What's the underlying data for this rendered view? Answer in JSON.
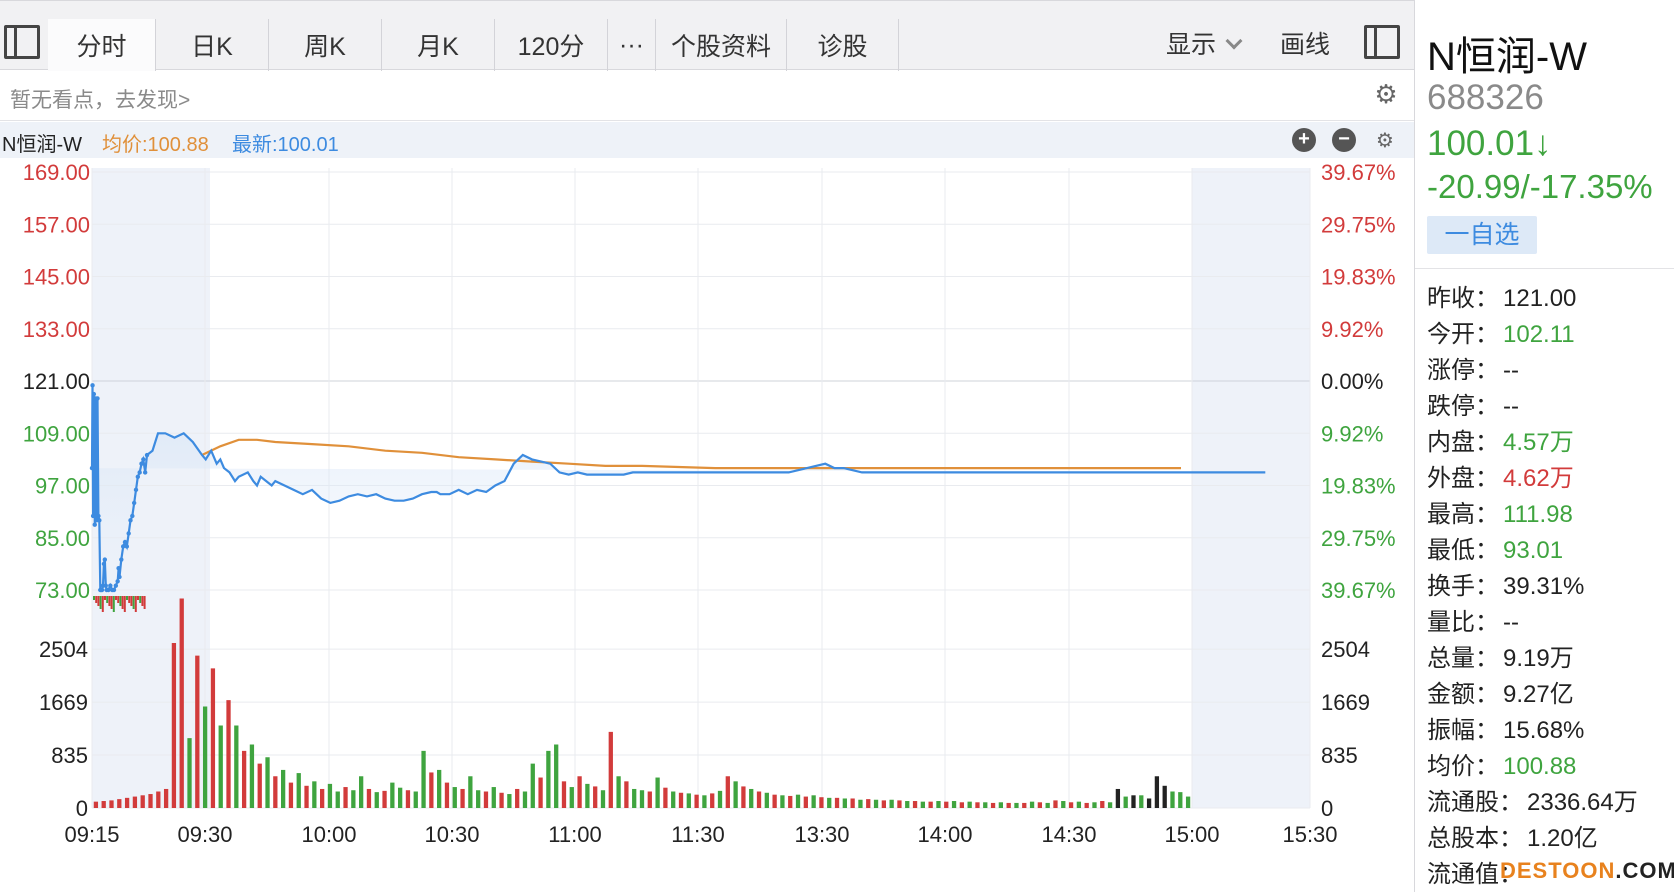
{
  "tabs": [
    {
      "label": "分时",
      "active": true
    },
    {
      "label": "日K",
      "active": false
    },
    {
      "label": "周K",
      "active": false
    },
    {
      "label": "月K",
      "active": false
    },
    {
      "label": "120分",
      "active": false
    },
    {
      "label": "···",
      "active": false
    },
    {
      "label": "个股资料",
      "active": false
    },
    {
      "label": "诊股",
      "active": false
    }
  ],
  "toolbar": {
    "display_label": "显示",
    "draw_label": "画线"
  },
  "hint_text": "暂无看点，去发现>",
  "legend": {
    "name": "N恒润-W",
    "avg": "均价:100.88",
    "latest": "最新:100.01"
  },
  "stock": {
    "name": "N恒润-W",
    "code": "688326",
    "price": "100.01↓",
    "change": "-20.99/-17.35%",
    "watch_label": "一自选"
  },
  "stats": [
    {
      "label": "昨收：",
      "value": "121.00",
      "color": "dark"
    },
    {
      "label": "今开：",
      "value": "102.11",
      "color": "green"
    },
    {
      "label": "涨停：",
      "value": "--",
      "color": "dark"
    },
    {
      "label": "跌停：",
      "value": "--",
      "color": "dark"
    },
    {
      "label": "内盘：",
      "value": "4.57万",
      "color": "green"
    },
    {
      "label": "外盘：",
      "value": "4.62万",
      "color": "red"
    },
    {
      "label": "最高：",
      "value": "111.98",
      "color": "green"
    },
    {
      "label": "最低：",
      "value": "93.01",
      "color": "green"
    },
    {
      "label": "换手：",
      "value": "39.31%",
      "color": "dark"
    },
    {
      "label": "量比：",
      "value": "--",
      "color": "dark"
    },
    {
      "label": "总量：",
      "value": "9.19万",
      "color": "dark"
    },
    {
      "label": "金额：",
      "value": "9.27亿",
      "color": "dark"
    },
    {
      "label": "振幅：",
      "value": "15.68%",
      "color": "dark"
    },
    {
      "label": "均价：",
      "value": "100.88",
      "color": "green"
    },
    {
      "label": "流通股：",
      "value": "2336.64万",
      "color": "dark"
    },
    {
      "label": "总股本：",
      "value": "1.20亿",
      "color": "dark"
    },
    {
      "label": "流通值：",
      "value": "",
      "color": "dark"
    }
  ],
  "watermark": {
    "brand": "DESTOON",
    "tail": ".COM"
  },
  "colors": {
    "up": "#d23b3b",
    "down": "#3fa43f",
    "price_line": "#3d8be0",
    "avg_line": "#e0903a"
  },
  "chart_data": {
    "type": "line",
    "price_axis": {
      "ticks": [
        169.0,
        157.0,
        145.0,
        133.0,
        121.0,
        109.0,
        97.0,
        85.0,
        73.0
      ],
      "labels": [
        "169.00",
        "157.00",
        "145.00",
        "133.00",
        "121.00",
        "109.00",
        "97.00",
        "85.00",
        "73.00"
      ],
      "pct_labels": [
        "39.67%",
        "29.75%",
        "19.83%",
        "9.92%",
        "0.00%",
        "9.92%",
        "19.83%",
        "29.75%",
        "39.67%"
      ],
      "prev_close": 121.0
    },
    "time_labels": [
      "09:15",
      "09:30",
      "10:00",
      "10:30",
      "11:00",
      "11:30",
      "13:30",
      "14:00",
      "14:30",
      "15:00",
      "15:30"
    ],
    "volume_axis": {
      "ticks": [
        2504,
        1669,
        835,
        0
      ],
      "labels": [
        "2504",
        "1669",
        "835",
        "0"
      ],
      "ylim": [
        0,
        3340
      ]
    },
    "series": [
      {
        "name": "最新",
        "t": [
          0,
          0.3,
          0.6,
          1,
          1.5,
          2,
          2.5,
          3,
          3.5,
          4,
          4.5,
          5,
          5.5,
          6,
          6.5,
          7,
          7.5,
          8,
          9,
          10,
          11,
          12,
          13,
          14,
          14.5,
          15,
          16,
          17,
          18,
          19,
          20,
          21,
          22,
          23,
          24,
          25,
          26,
          27,
          28,
          29,
          30,
          33,
          36,
          40,
          45,
          50,
          55,
          60,
          62,
          65,
          68,
          70,
          72,
          75,
          78,
          80,
          85,
          88,
          90,
          92,
          95,
          98,
          100,
          105,
          110,
          115,
          120,
          125,
          130,
          135,
          140,
          145,
          150,
          155,
          160,
          165,
          170,
          175,
          180,
          185,
          188,
          190,
          195,
          200,
          205,
          210,
          215,
          220,
          225,
          230,
          235,
          240,
          245,
          250,
          255,
          260,
          265,
          270,
          275,
          280,
          285,
          290,
          295,
          300,
          310,
          320,
          330,
          340,
          350,
          360,
          370,
          380,
          390,
          400,
          405,
          410,
          420,
          430,
          440,
          450,
          460,
          465,
          470,
          480,
          490,
          500,
          510,
          520,
          530,
          540,
          550,
          560,
          570,
          580,
          590,
          600,
          610,
          620,
          630,
          640,
          650,
          660
        ],
        "values": [
          101,
          120,
          90,
          118,
          88,
          117,
          89,
          117,
          90,
          89,
          73,
          73,
          73,
          74,
          79,
          80,
          74,
          73,
          73,
          74,
          73,
          73,
          74,
          75,
          78,
          76,
          80,
          83,
          84,
          83,
          86,
          89,
          90,
          93,
          96,
          99,
          100,
          102,
          103,
          100,
          104,
          105,
          109,
          109,
          108,
          109,
          107,
          104,
          103,
          105,
          102,
          103,
          101,
          100,
          98,
          99,
          100,
          98,
          97,
          99,
          98,
          97,
          98,
          97,
          96,
          95,
          96,
          94,
          93,
          93.5,
          94.5,
          95,
          94.5,
          95,
          94,
          93.5,
          93.5,
          94,
          95,
          95.5,
          95.5,
          95,
          95,
          96,
          95,
          96,
          95.5,
          97,
          98,
          102,
          104,
          103,
          102.5,
          102,
          100,
          99.5,
          100,
          99.5,
          99.5,
          99.5,
          99.5,
          99.5,
          100,
          100,
          100,
          100,
          100,
          100,
          100,
          100,
          100,
          100,
          101,
          102,
          101,
          101,
          100,
          100,
          100,
          100,
          100,
          100,
          100,
          100,
          100,
          100,
          100,
          100,
          100,
          100,
          100,
          100,
          100,
          100,
          100,
          100,
          100,
          100,
          100,
          100
        ]
      },
      {
        "name": "均价",
        "t": [
          60,
          70,
          80,
          90,
          100,
          120,
          140,
          160,
          180,
          200,
          220,
          240,
          260,
          280,
          300,
          340,
          380,
          420,
          460,
          500,
          540,
          594
        ],
        "values": [
          104,
          106,
          107.5,
          107.5,
          107,
          106.5,
          106,
          105,
          104.5,
          103.5,
          103,
          102.5,
          102,
          101.5,
          101.5,
          101,
          101,
          101,
          101,
          101,
          101,
          101
        ]
      }
    ],
    "volume": {
      "note": "per-minute volume bars; color up=red, down=green",
      "values": [
        100,
        110,
        120,
        140,
        160,
        180,
        200,
        220,
        260,
        300,
        2600,
        3300,
        1100,
        2400,
        1600,
        2200,
        1300,
        1700,
        1300,
        900,
        1000,
        700,
        800,
        500,
        600,
        400,
        550,
        350,
        420,
        300,
        380,
        260,
        330,
        280,
        500,
        300,
        250,
        270,
        400,
        320,
        280,
        260,
        900,
        560,
        600,
        400,
        330,
        300,
        500,
        280,
        260,
        330,
        240,
        220,
        300,
        260,
        700,
        480,
        900,
        1000,
        420,
        330,
        500,
        380,
        340,
        280,
        1200,
        500,
        420,
        300,
        280,
        260,
        480,
        320,
        260,
        240,
        230,
        210,
        200,
        230,
        270,
        500,
        420,
        340,
        300,
        260,
        240,
        210,
        200,
        190,
        210,
        180,
        200,
        170,
        160,
        160,
        150,
        150,
        130,
        140,
        130,
        120,
        130,
        120,
        110,
        110,
        100,
        100,
        110,
        100,
        110,
        90,
        100,
        90,
        90,
        80,
        90,
        80,
        80,
        80,
        100,
        90,
        80,
        120,
        110,
        90,
        100,
        80,
        90,
        110,
        90,
        300,
        180,
        200,
        200,
        150,
        500,
        350,
        260,
        250,
        180
      ],
      "colors": [
        "r",
        "r",
        "r",
        "r",
        "r",
        "r",
        "r",
        "r",
        "r",
        "r",
        "r",
        "r",
        "g",
        "r",
        "g",
        "r",
        "g",
        "r",
        "g",
        "r",
        "g",
        "r",
        "g",
        "r",
        "g",
        "r",
        "g",
        "r",
        "g",
        "r",
        "g",
        "g",
        "r",
        "g",
        "g",
        "r",
        "g",
        "r",
        "g",
        "g",
        "r",
        "g",
        "g",
        "r",
        "g",
        "r",
        "g",
        "r",
        "g",
        "g",
        "r",
        "g",
        "r",
        "g",
        "r",
        "g",
        "g",
        "r",
        "g",
        "g",
        "r",
        "g",
        "r",
        "g",
        "r",
        "g",
        "r",
        "g",
        "r",
        "g",
        "g",
        "r",
        "g",
        "r",
        "g",
        "r",
        "g",
        "r",
        "g",
        "r",
        "g",
        "r",
        "g",
        "r",
        "g",
        "r",
        "g",
        "r",
        "g",
        "r",
        "g",
        "r",
        "g",
        "r",
        "g",
        "r",
        "g",
        "r",
        "g",
        "r",
        "g",
        "r",
        "g",
        "r",
        "g",
        "r",
        "g",
        "r",
        "g",
        "r",
        "g",
        "r",
        "g",
        "r",
        "g",
        "r",
        "g",
        "r",
        "g",
        "r",
        "g",
        "r",
        "g",
        "r",
        "g",
        "r",
        "g",
        "r",
        "g",
        "r",
        "g",
        "k",
        "g",
        "k",
        "g",
        "k",
        "k",
        "k",
        "g",
        "g",
        "g"
      ]
    }
  }
}
